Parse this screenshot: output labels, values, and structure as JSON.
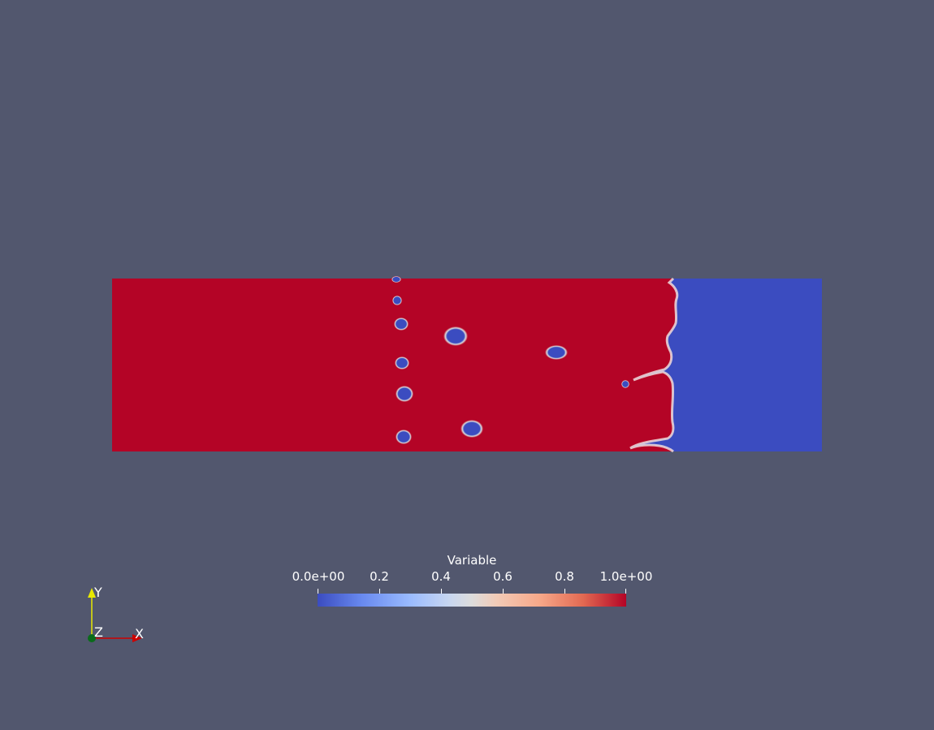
{
  "colorbar": {
    "title": "Variable",
    "ticks": [
      {
        "value": 0.0,
        "label": "0.0e+00"
      },
      {
        "value": 0.2,
        "label": "0.2"
      },
      {
        "value": 0.4,
        "label": "0.4"
      },
      {
        "value": 0.6,
        "label": "0.6"
      },
      {
        "value": 0.8,
        "label": "0.8"
      },
      {
        "value": 1.0,
        "label": "1.0e+00"
      }
    ],
    "colormap": [
      "#3b4cc0",
      "#b40426"
    ]
  },
  "axes": {
    "x_label": "X",
    "y_label": "Y",
    "z_label": "Z"
  },
  "colors": {
    "background": "#52576e",
    "high_value": "#b40426",
    "low_value": "#3b4cc0"
  }
}
